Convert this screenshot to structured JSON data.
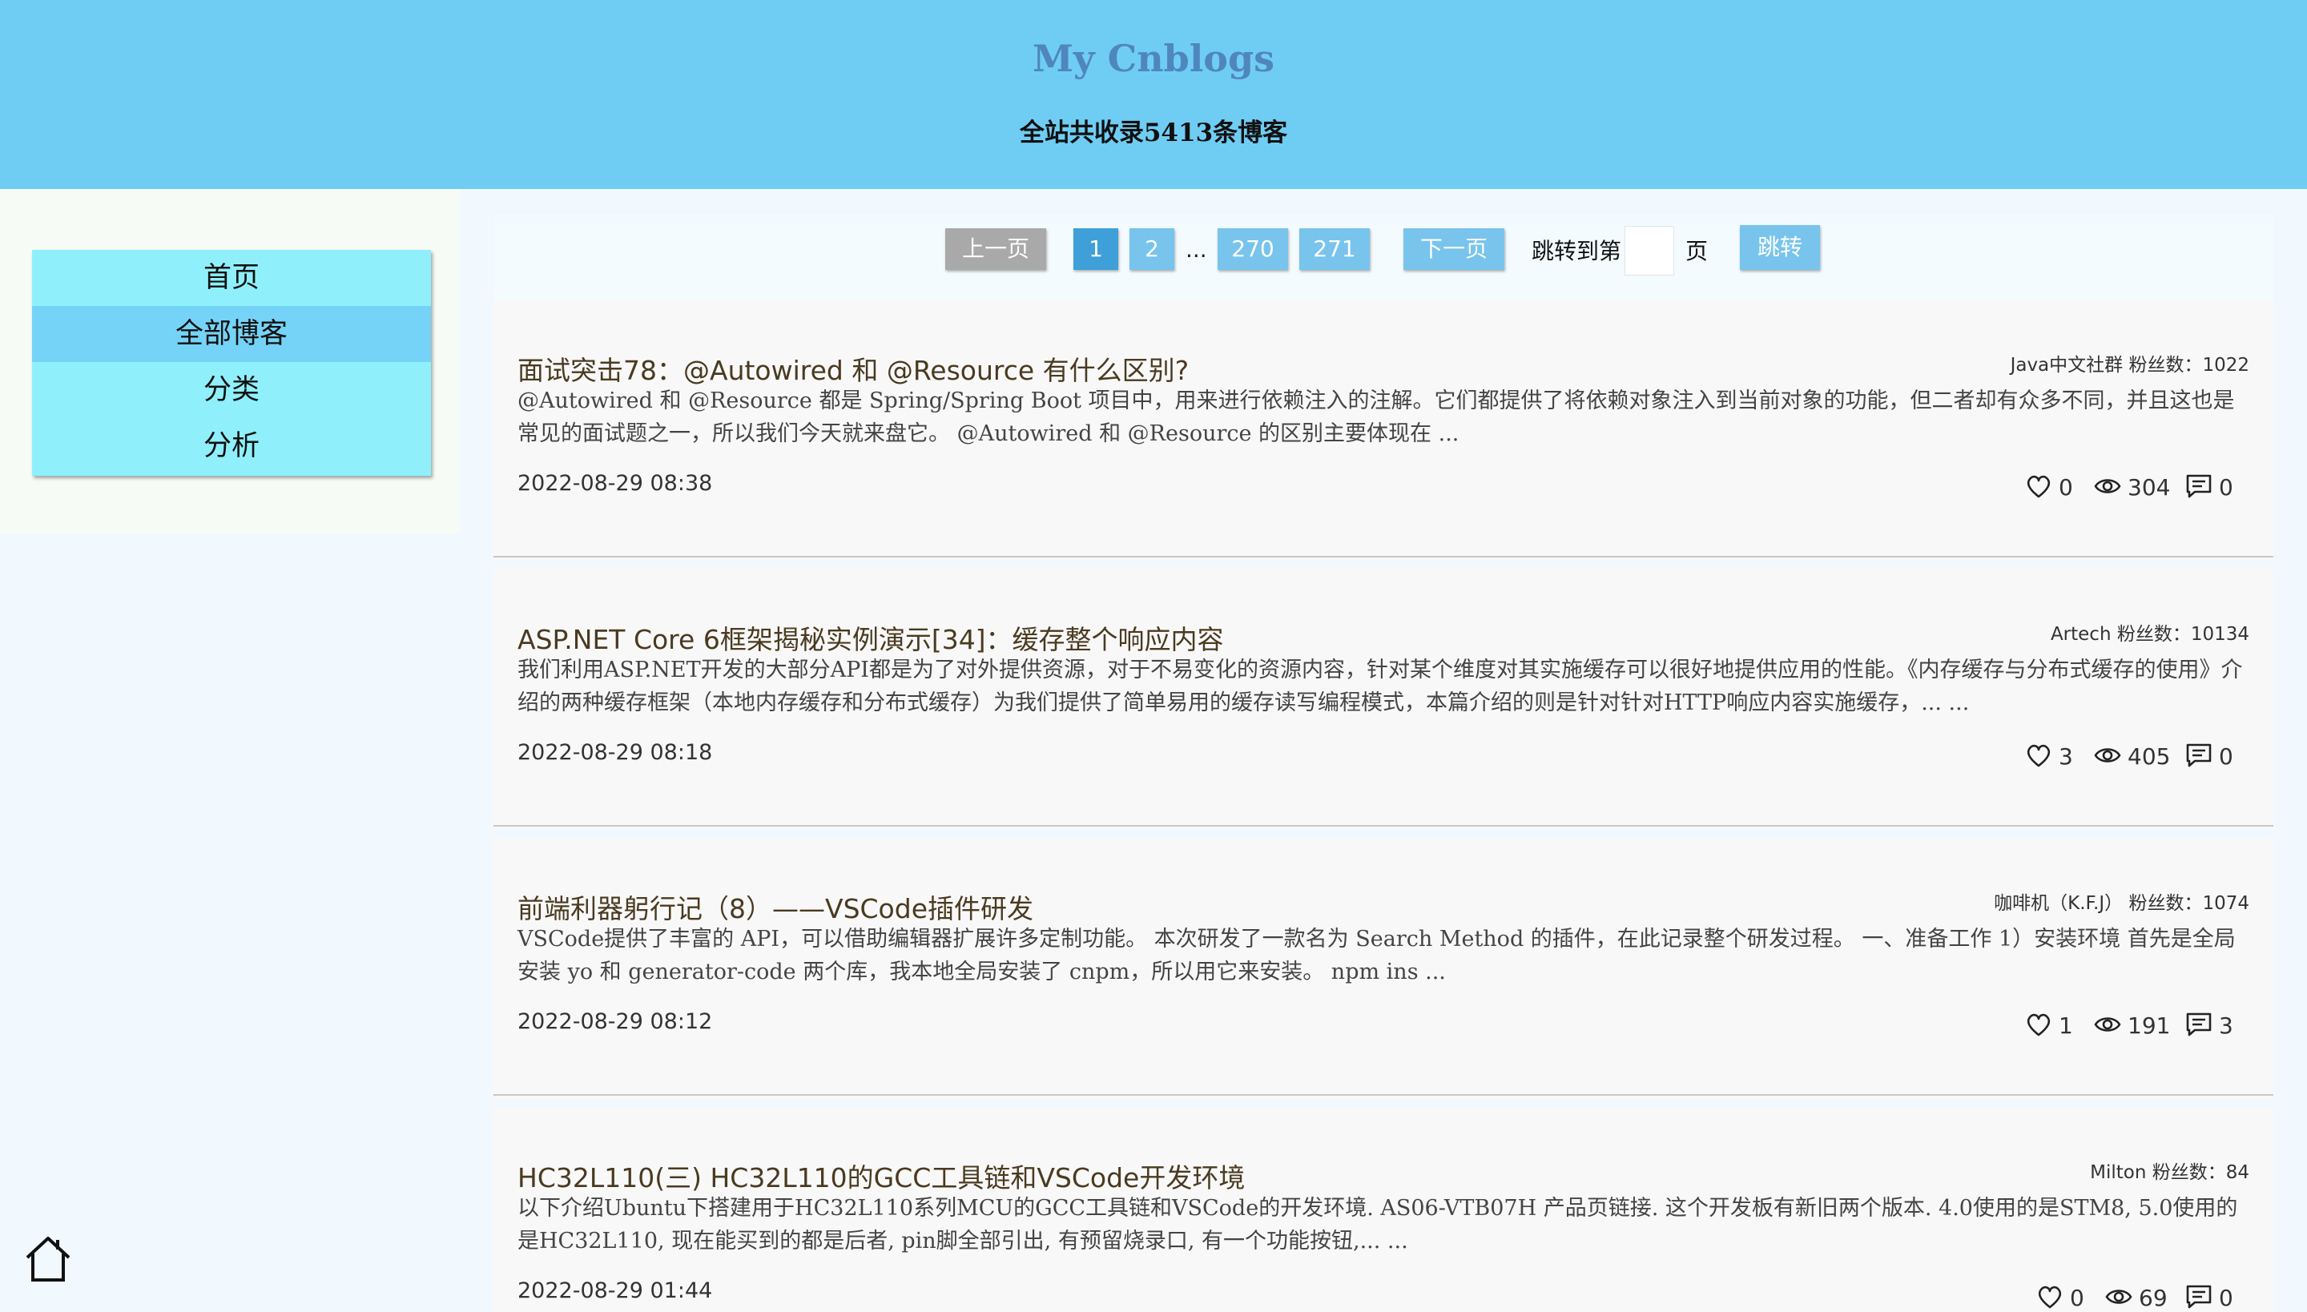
{
  "header": {
    "title": "My Cnblogs",
    "subtitle": "全站共收录5413条博客"
  },
  "nav": {
    "items": [
      {
        "label": "首页"
      },
      {
        "label": "全部博客"
      },
      {
        "label": "分类"
      },
      {
        "label": "分析"
      }
    ]
  },
  "pager": {
    "prev": "上一页",
    "pages": [
      "1",
      "2",
      "270",
      "271"
    ],
    "ellipsis": "...",
    "current": "1",
    "next": "下一页",
    "jump_prefix": "跳转到第",
    "jump_value": "",
    "jump_suffix": "页",
    "jump_button": "跳转"
  },
  "posts": [
    {
      "title": "面试突击78：@Autowired 和 @Resource 有什么区别?",
      "author_meta": "Java中文社群 粉丝数：1022",
      "summary": "@Autowired 和 @Resource 都是 Spring/Spring Boot 项目中，用来进行依赖注入的注解。它们都提供了将依赖对象注入到当前对象的功能，但二者却有众多不同，并且这也是常见的面试题之一，所以我们今天就来盘它。 @Autowired 和 @Resource 的区别主要体现在 ...",
      "date": "2022-08-29 08:38",
      "likes": "0",
      "views": "304",
      "comments": "0"
    },
    {
      "title": "ASP.NET Core 6框架揭秘实例演示[34]：缓存整个响应内容",
      "author_meta": "Artech 粉丝数：10134",
      "summary": "我们利用ASP.NET开发的大部分API都是为了对外提供资源，对于不易变化的资源内容，针对某个维度对其实施缓存可以很好地提供应用的性能。《内存缓存与分布式缓存的使用》介绍的两种缓存框架（本地内存缓存和分布式缓存）为我们提供了简单易用的缓存读写编程模式，本篇介绍的则是针对针对HTTP响应内容实施缓存，... ...",
      "date": "2022-08-29 08:18",
      "likes": "3",
      "views": "405",
      "comments": "0"
    },
    {
      "title": "前端利器躬行记（8）——VSCode插件研发",
      "author_meta": "咖啡机（K.F.J） 粉丝数：1074",
      "summary": "VSCode提供了丰富的 API，可以借助编辑器扩展许多定制功能。 本次研发了一款名为 Search Method 的插件，在此记录整个研发过程。 一、准备工作 1）安装环境 首先是全局安装 yo 和 generator-code 两个库，我本地全局安装了 cnpm，所以用它来安装。 npm ins ...",
      "date": "2022-08-29 08:12",
      "likes": "1",
      "views": "191",
      "comments": "3"
    },
    {
      "title": "HC32L110(三) HC32L110的GCC工具链和VSCode开发环境",
      "author_meta": "Milton 粉丝数：84",
      "summary": "以下介绍Ubuntu下搭建用于HC32L110系列MCU的GCC工具链和VSCode的开发环境. AS06-VTB07H 产品页链接. 这个开发板有新旧两个版本. 4.0使用的是STM8, 5.0使用的是HC32L110, 现在能买到的都是后者, pin脚全部引出, 有预留烧录口, 有一个功能按钮,... ...",
      "date": "2022-08-29 01:44",
      "likes": "0",
      "views": "69",
      "comments": "0"
    }
  ],
  "icons": {
    "home": "home-icon",
    "like": "heart-icon",
    "views": "eye-icon",
    "comments": "comment-icon"
  }
}
